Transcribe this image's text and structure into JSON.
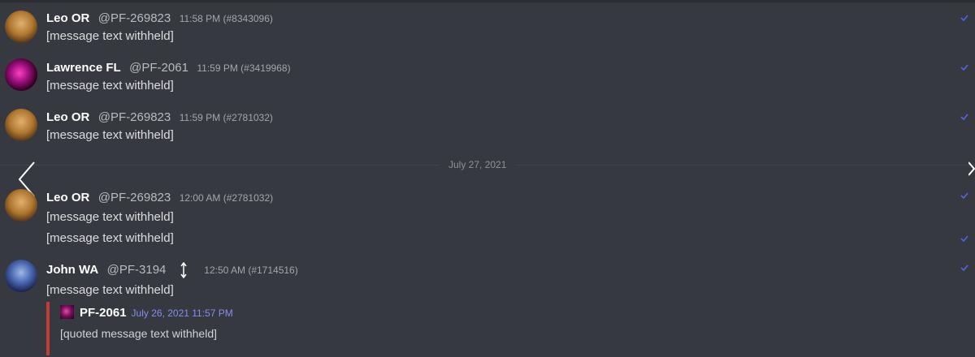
{
  "messages": [
    {
      "name": "Leo OR",
      "handle": "@PF-269823",
      "time": "11:58 PM (#8343096)",
      "text": "[message text withheld]",
      "avatar": "lion-avatar"
    },
    {
      "name": "Lawrence FL",
      "handle": "@PF-2061",
      "time": "11:59 PM (#3419968)",
      "text": "[message text withheld]",
      "avatar": "pink-avatar"
    },
    {
      "name": "Leo OR",
      "handle": "@PF-269823",
      "time": "11:59 PM (#2781032)",
      "text": "[message text withheld]",
      "avatar": "lion-avatar"
    },
    {
      "name": "Leo OR",
      "handle": "@PF-269823",
      "time": "12:00 AM (#2781032)",
      "text": "[message text withheld]",
      "text2": "[message text withheld]",
      "avatar": "lion-avatar"
    },
    {
      "name": "John WA",
      "handle": "@PF-3194",
      "time": "12:50 AM (#1714516)",
      "text": "[message text withheld]",
      "avatar": "blue-avatar"
    }
  ],
  "divider": {
    "date": "July 27, 2021"
  },
  "reply": {
    "name": "PF-2061",
    "date": "July 26, 2021 11:57 PM",
    "text": "[quoted message text withheld]"
  },
  "colors": {
    "background": "#36393f",
    "reply_accent": "#c23a3a",
    "check": "#5865f2"
  },
  "icons": [
    "check-icon",
    "arrow-up-down-icon",
    "chevron-left-icon",
    "chevron-right-icon"
  ]
}
